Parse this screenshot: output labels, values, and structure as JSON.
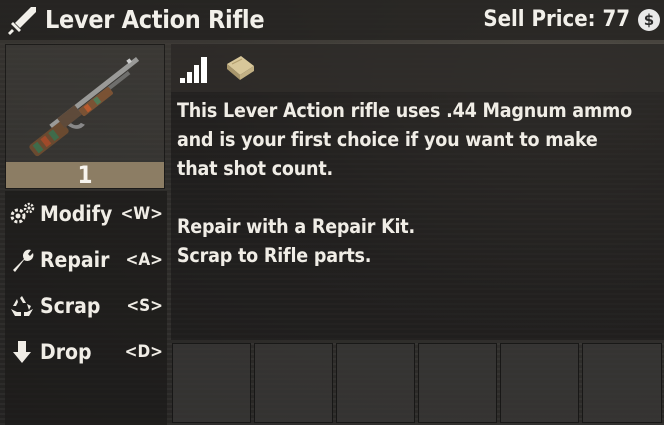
{
  "header": {
    "title": "Lever Action Rifle",
    "sell_price_label": "Sell Price: 77",
    "currency_icon": "dollar-coin-icon",
    "currency_glyph": "$"
  },
  "item": {
    "count": "1",
    "quality_icon": "quality-bars-icon",
    "info_icon": "book-icon"
  },
  "actions": [
    {
      "label": "Modify",
      "key": "<W>",
      "icon": "gears-icon"
    },
    {
      "label": "Repair",
      "key": "<A>",
      "icon": "wrench-icon"
    },
    {
      "label": "Scrap",
      "key": "<S>",
      "icon": "recycle-icon"
    },
    {
      "label": "Drop",
      "key": "<D>",
      "icon": "arrow-down-icon"
    }
  ],
  "description": "This Lever Action rifle uses .44 Magnum ammo\nand is your first choice if you want to make\nthat shot count.\n\nRepair with a Repair Kit.\nScrap to Rifle parts.",
  "colors": {
    "count_bar": "#8c7d64",
    "text": "#f0ede6",
    "quality_bars": "#ffffff"
  }
}
